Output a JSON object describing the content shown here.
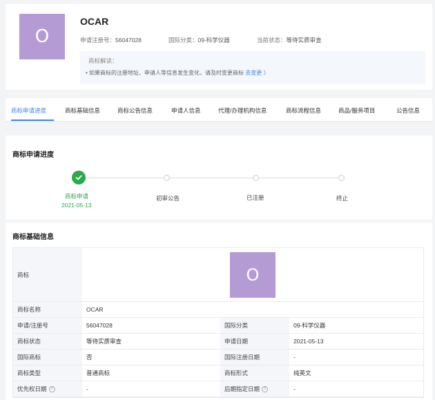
{
  "header": {
    "logo_letter": "O",
    "brand_name": "OCAR",
    "reg_no_label": "申请注册号：",
    "reg_no": "56047028",
    "class_label": "国际分类：",
    "class_value": "09-科学仪器",
    "status_label": "当前状态：",
    "status_value": "等待实质审查",
    "notice_title": "商标解读：",
    "notice_text": "• 如果商标的注册地址、申请人等信息发生变化，请及时变更商标",
    "notice_link": "去变更 〉"
  },
  "tabs": [
    {
      "label": "商标申请进度"
    },
    {
      "label": "商标基础信息"
    },
    {
      "label": "商标公告信息"
    },
    {
      "label": "申请人信息"
    },
    {
      "label": "代理/办理机构信息"
    },
    {
      "label": "商标流程信息"
    },
    {
      "label": "商品/服务项目"
    },
    {
      "label": "公告信息"
    }
  ],
  "progress": {
    "title": "商标申请进度",
    "steps": [
      {
        "label": "商标申请",
        "date": "2021-05-13",
        "status": "done"
      },
      {
        "label": "初审公告",
        "status": "pending"
      },
      {
        "label": "已注册",
        "status": "pending"
      },
      {
        "label": "终止",
        "status": "pending"
      }
    ]
  },
  "basic_info": {
    "title": "商标基础信息",
    "logo_label": "商标",
    "logo_letter": "O",
    "rows": [
      {
        "k1": "商标名称",
        "v1": "OCAR"
      },
      {
        "k1": "申请/注册号",
        "v1": "56047028",
        "k2": "国际分类",
        "v2": "09-科学仪器"
      },
      {
        "k1": "商标状态",
        "v1": "等待实质审查",
        "k2": "申请日期",
        "v2": "2021-05-13"
      },
      {
        "k1": "国际商标",
        "v1": "否",
        "k2": "国际注册日期",
        "v2": "-"
      },
      {
        "k1": "商标类型",
        "v1": "普通商标",
        "k2": "商标形式",
        "v2": "纯英文"
      },
      {
        "k1": "优先权日期",
        "v1": "-",
        "k2": "后期指定日期",
        "v2": "-"
      }
    ]
  },
  "colors": {
    "accent": "#3a86f0",
    "done": "#2ea84a",
    "logo": "#b59bd3"
  }
}
